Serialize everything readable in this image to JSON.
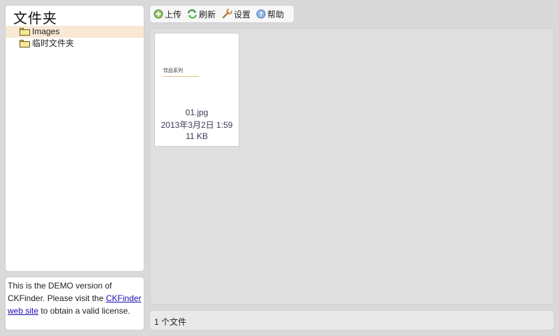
{
  "folders": {
    "title": "文件夹",
    "items": [
      {
        "label": "Images",
        "icon": "folder-icon",
        "selected": true
      },
      {
        "label": "临时文件夹",
        "icon": "folder-icon",
        "selected": false
      }
    ]
  },
  "demo_note": {
    "text_before": "This is the DEMO version of CKFinder. Please visit the",
    "link_text": "CKFinder web site",
    "text_after": "to obtain a valid license."
  },
  "toolbar": {
    "buttons": [
      {
        "label": "上传",
        "icon": "upload-icon",
        "color": "#5aa83a"
      },
      {
        "label": "刷新",
        "icon": "refresh-icon",
        "color": "#3d9a3d"
      },
      {
        "label": "设置",
        "icon": "settings-icon",
        "color": "#c98a3a"
      },
      {
        "label": "帮助",
        "icon": "help-icon",
        "color": "#4a7fc0"
      }
    ]
  },
  "files": [
    {
      "thumbnail_text": "饮品系列",
      "name": "01.jpg",
      "date": "2013年3月2日 1:59",
      "size": "11 KB"
    }
  ],
  "status": {
    "text": "1 个文件"
  },
  "colors": {
    "selected_folder_bg": "#f8e8d4",
    "link": "#1a0dab",
    "page_bg": "#d9d9d9"
  }
}
